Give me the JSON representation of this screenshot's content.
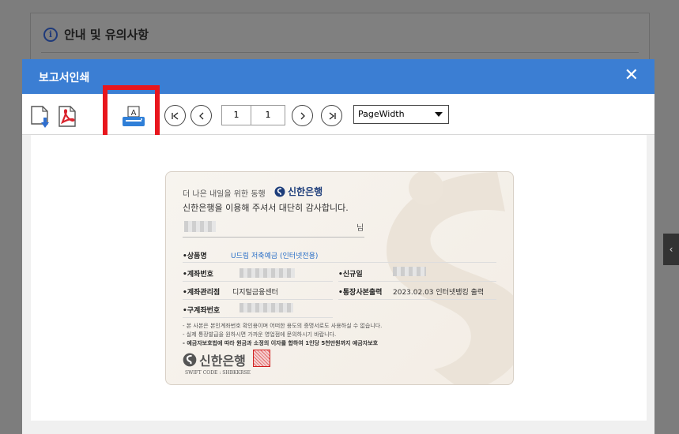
{
  "background": {
    "notice_title": "안내 및 유의사항"
  },
  "dialog": {
    "title": "보고서인쇄",
    "close": "✕"
  },
  "toolbar": {
    "print_icon_letter": "A",
    "current_page": "1",
    "total_pages": "1",
    "zoom": "PageWidth"
  },
  "passbook": {
    "greeting_line1": "더 나은 내일을 위한 동행",
    "bank_name": "신한은행",
    "greeting_line2": "신한은행을 이용해 주셔서 대단히 감사합니다.",
    "honorific": "님",
    "rows": {
      "product_label": "•상품명",
      "product_value": "U드림 저축예금 (인터넷전용)",
      "account_label": "•계좌번호",
      "new_label": "•신규일",
      "branch_label": "•계좌관리점",
      "branch_value": "디지털금융센터",
      "print_label": "•통장사본출력",
      "print_value": "2023.02.03 인터넷뱅킹 출력",
      "old_account_label": "•구계좌번호"
    },
    "notes": [
      "- 본 사본은 본인계좌번호 확인용이며 어떠한 용도의 증명서로도 사용하실 수 없습니다.",
      "- 실제 통장발급을 원하시면 가까운 영업점에 문의하시기 바랍니다.",
      "- 예금자보호법에 따라 원금과 소정의 이자를 합하여 1인당 5천만원까지 예금자보호"
    ],
    "swift_code": "SWIFT CODE : SHBKKRSE"
  },
  "colors": {
    "titlebar": "#3b7ed3",
    "highlight": "#e8161d",
    "brand_navy": "#1d3d7a"
  }
}
